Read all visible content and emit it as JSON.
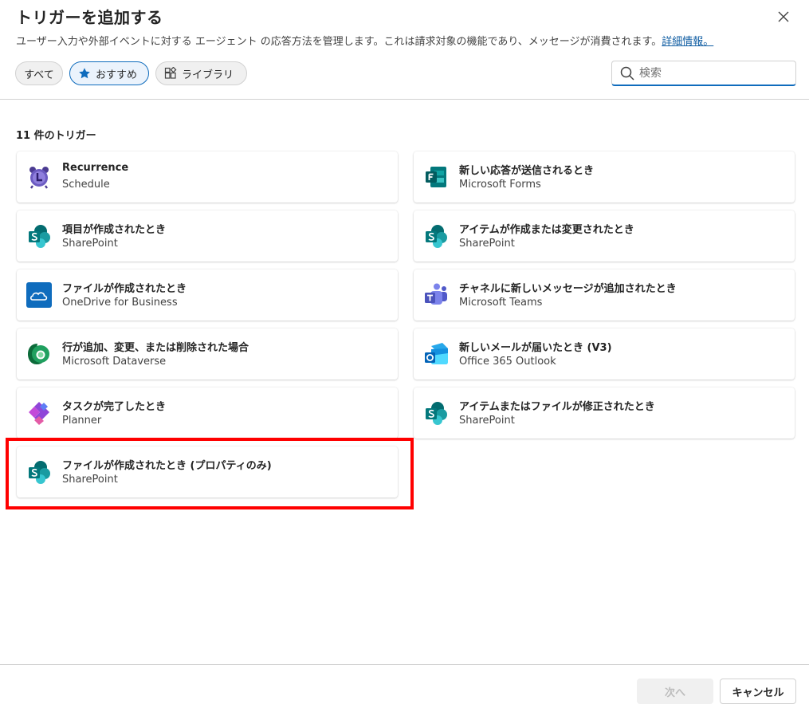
{
  "dialog": {
    "title": "トリガーを追加する",
    "subtitle": "ユーザー入力や外部イベントに対する エージェント の応答方法を管理します。これは請求対象の機能であり、メッセージが消費されます。",
    "learn_more": "詳細情報。"
  },
  "filters": {
    "all": "すべて",
    "recommended": "おすすめ",
    "library": "ライブラリ",
    "selected": "おすすめ"
  },
  "search": {
    "placeholder": "検索",
    "value": ""
  },
  "count_label": "11 件のトリガー",
  "triggers": [
    {
      "name": "Recurrence",
      "connector": "Schedule",
      "icon": "alarm-clock-icon"
    },
    {
      "name": "新しい応答が送信されるとき",
      "connector": "Microsoft Forms",
      "icon": "forms-icon"
    },
    {
      "name": "項目が作成されたとき",
      "connector": "SharePoint",
      "icon": "sharepoint-icon"
    },
    {
      "name": "アイテムが作成または変更されたとき",
      "connector": "SharePoint",
      "icon": "sharepoint-icon"
    },
    {
      "name": "ファイルが作成されたとき",
      "connector": "OneDrive for Business",
      "icon": "onedrive-icon"
    },
    {
      "name": "チャネルに新しいメッセージが追加されたとき",
      "connector": "Microsoft Teams",
      "icon": "teams-icon"
    },
    {
      "name": "行が追加、変更、または削除された場合",
      "connector": "Microsoft Dataverse",
      "icon": "dataverse-icon"
    },
    {
      "name": "新しいメールが届いたとき (V3)",
      "connector": "Office 365 Outlook",
      "icon": "outlook-icon"
    },
    {
      "name": "タスクが完了したとき",
      "connector": "Planner",
      "icon": "planner-icon"
    },
    {
      "name": "アイテムまたはファイルが修正されたとき",
      "connector": "SharePoint",
      "icon": "sharepoint-icon"
    },
    {
      "name": "ファイルが作成されたとき (プロパティのみ)",
      "connector": "SharePoint",
      "icon": "sharepoint-icon"
    }
  ],
  "footer": {
    "next": "次へ",
    "cancel": "キャンセル"
  },
  "colors": {
    "accent": "#0f6cbd",
    "highlight": "#ff0000",
    "link": "#115ea3"
  }
}
